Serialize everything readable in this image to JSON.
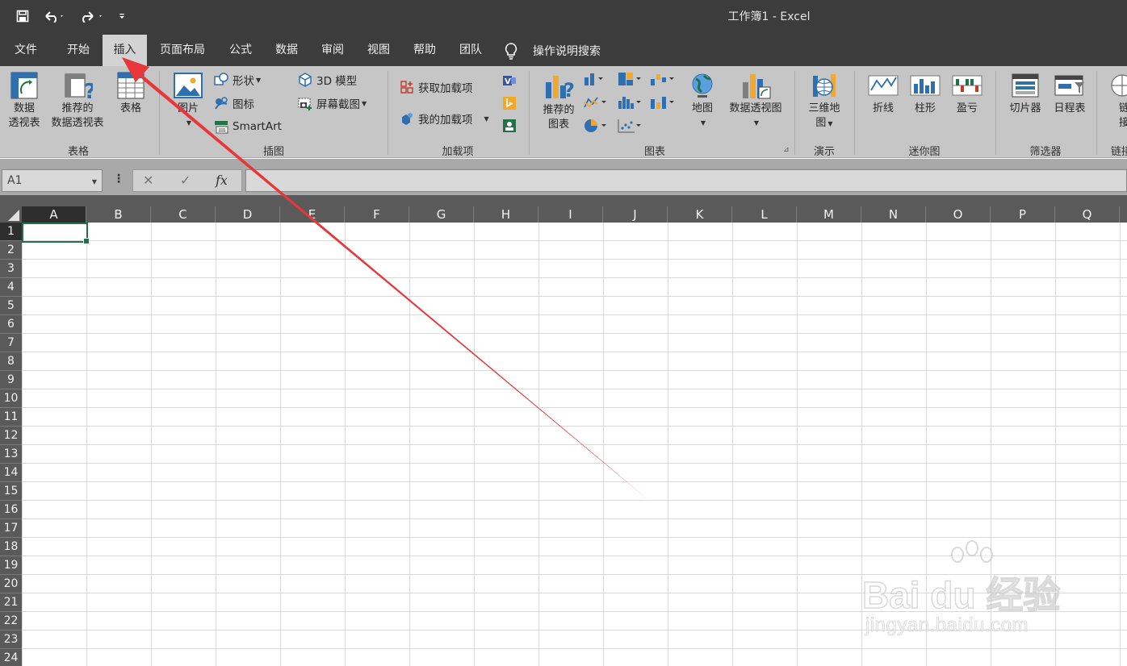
{
  "window": {
    "title": "工作簿1  -  Excel"
  },
  "tabs": [
    {
      "label": "文件"
    },
    {
      "label": "开始"
    },
    {
      "label": "插入"
    },
    {
      "label": "页面布局"
    },
    {
      "label": "公式"
    },
    {
      "label": "数据"
    },
    {
      "label": "审阅"
    },
    {
      "label": "视图"
    },
    {
      "label": "帮助"
    },
    {
      "label": "团队"
    }
  ],
  "active_tab": "插入",
  "tell_me": "操作说明搜索",
  "ribbon": {
    "groups": {
      "tables": "表格",
      "illustrations": "插图",
      "addins": "加载项",
      "charts": "图表",
      "tours": "演示",
      "sparklines": "迷你图",
      "filters": "筛选器",
      "links": "链接"
    },
    "pivot_table": [
      "数据",
      "透视表"
    ],
    "recommended_pivot": [
      "推荐的",
      "数据透视表"
    ],
    "table": "表格",
    "pictures": "图片",
    "shapes": "形状",
    "icons": "图标",
    "smartart": "SmartArt",
    "model3d": "3D 模型",
    "screenshot": "屏幕截图",
    "get_addins": "获取加载项",
    "my_addins": "我的加载项",
    "recommended_charts": [
      "推荐的",
      "图表"
    ],
    "maps": "地图",
    "pivot_chart": "数据透视图",
    "map3d": [
      "三维地",
      "图"
    ],
    "line": "折线",
    "column": "柱形",
    "winloss": "盈亏",
    "slicer": "切片器",
    "timeline": "日程表",
    "link": [
      "链",
      "接"
    ]
  },
  "formula_bar": {
    "name_box": "A1",
    "fx": "fx",
    "value": ""
  },
  "sheet": {
    "columns": [
      "A",
      "B",
      "C",
      "D",
      "E",
      "F",
      "G",
      "H",
      "I",
      "J",
      "K",
      "L",
      "M",
      "N",
      "O",
      "P",
      "Q"
    ],
    "rows": [
      "1",
      "2",
      "3",
      "4",
      "5",
      "6",
      "7",
      "8",
      "9",
      "10",
      "11",
      "12",
      "13",
      "14",
      "15",
      "16",
      "17",
      "18",
      "19",
      "20",
      "21",
      "22",
      "23",
      "24"
    ],
    "active_cell": "A1"
  },
  "watermark": {
    "line1": "Bai du 经验",
    "line2": "jingyan.baidu.com"
  },
  "colors": {
    "title_bg": "#3c3c3c",
    "ribbon_bg": "#c6c6c6",
    "excel_green": "#217346",
    "arrow": "#e8373a"
  }
}
